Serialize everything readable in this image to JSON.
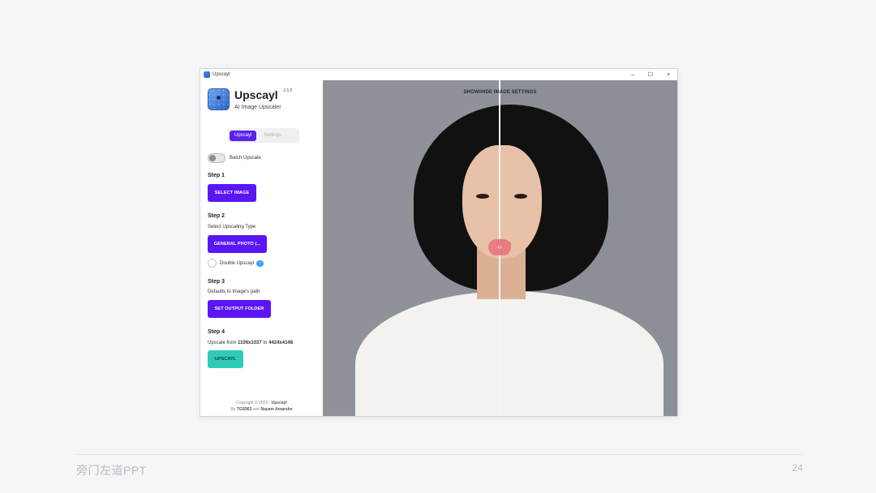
{
  "window": {
    "title": "Upscayl",
    "controls": {
      "minimize": "–",
      "maximize": "☐",
      "close": "×"
    }
  },
  "sidebar": {
    "app_name": "Upscayl",
    "version": "2.5.5",
    "subtitle": "AI Image Upscaler",
    "tabs": [
      {
        "label": "Upscayl",
        "active": true
      },
      {
        "label": "Settings",
        "active": false
      }
    ],
    "batch_toggle": {
      "label": "Batch Upscale",
      "on": false
    },
    "step1": {
      "title": "Step 1",
      "button": "SELECT IMAGE"
    },
    "step2": {
      "title": "Step 2",
      "subtitle": "Select Upscaling Type",
      "button": "GENERAL PHOTO (...",
      "double_label": "Double Upscayl",
      "info_badge": "i"
    },
    "step3": {
      "title": "Step 3",
      "subtitle": "Defaults to Image's path",
      "button": "SET OUTPUT FOLDER"
    },
    "step4": {
      "title": "Step 4",
      "prefix": "Upscale from",
      "from_size": "1106x1037",
      "to_word": "to",
      "to_size": "4424x4148",
      "button": "UPSCAYL"
    },
    "footer": {
      "copyright": "Copyright © 2023 -",
      "app": "Upscayl",
      "by": "By",
      "author1": "TGS963",
      "and": "and",
      "author2": "Nayam Amarshe"
    }
  },
  "viewer": {
    "toggle_label": "SHOW/HIDE IMAGE SETTINGS",
    "compare_handle": "‹›",
    "image_subject": "portrait-photo"
  },
  "slide": {
    "brand": "旁门左道PPT",
    "page_number": "24"
  },
  "colors": {
    "accent": "#5b16f5",
    "teal": "#2fcab8",
    "viewer_bg": "#8f9399"
  }
}
